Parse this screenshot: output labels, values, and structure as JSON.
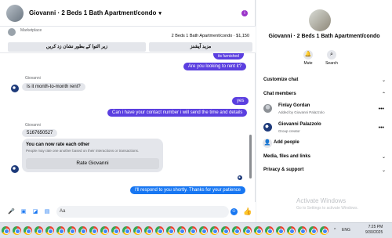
{
  "chat": {
    "title": "Giovanni · 2 Beds 1 Bath Apartment/condo",
    "more_badge": "i",
    "marketplace_label": "Marketplace",
    "listing": "2 Beds 1 Bath Apartment/condo · $1,150",
    "button_1": "زیر التوا کے بطور نشان زد کریں",
    "button_2": "مزید آپشنز",
    "partial_top": "its furnished",
    "msg_1": "Are you looking to rent it?",
    "sender_1": "Giovanni",
    "msg_2": "Is it month-to-month rent?",
    "msg_3": "yes",
    "msg_4": "Can i have your contact number i will send the time and details",
    "sender_2": "Giovanni",
    "msg_5": "5167650527",
    "rate_title": "You can now rate each other",
    "rate_sub": "People may rate one another based on their interactions or transactions.",
    "rate_button": "Rate Giovanni",
    "msg_6": "I'll respond to you shortly. Thanks for your patience",
    "composer_value": "Aa"
  },
  "info": {
    "title": "Giovanni · 2 Beds 1 Bath Apartment/condo",
    "mute_label": "Mute",
    "search_label": "Search",
    "customize_chat": "Customize chat",
    "chat_members": "Chat members",
    "members": [
      {
        "name": "Finlay Gordan",
        "sub": "Added by Giovanni Palazzolo"
      },
      {
        "name": "Giovanni Palazzolo",
        "sub": "Group creator"
      }
    ],
    "add_people": "Add people",
    "media": "Media, files and links",
    "privacy": "Privacy & support"
  },
  "watermark": {
    "line1": "Activate Windows",
    "line2": "Go to Settings to activate Windows."
  },
  "taskbar": {
    "time": "7:25 PM",
    "date": "9/30/2025",
    "tray_1": "^",
    "tray_2": "ENG"
  },
  "colors": {
    "accent": "#5b3fe0",
    "link_blue": "#1877f2"
  }
}
